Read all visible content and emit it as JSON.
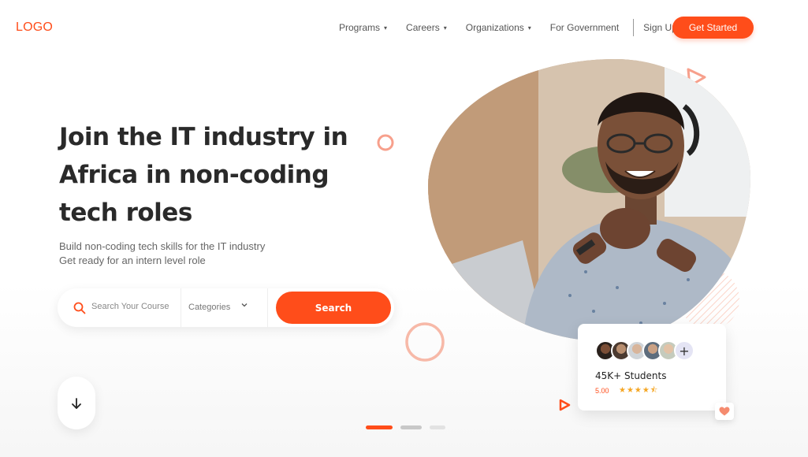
{
  "header": {
    "logo": "LOGO",
    "nav": [
      {
        "label": "Programs",
        "has_dropdown": true
      },
      {
        "label": "Careers",
        "has_dropdown": true
      },
      {
        "label": "Organizations",
        "has_dropdown": true
      },
      {
        "label": "For Government",
        "has_dropdown": false
      }
    ],
    "sign_up": "Sign Up",
    "get_started": "Get Started"
  },
  "hero": {
    "headline_lines": [
      "Join the IT industry in",
      "Africa in non-coding",
      "tech roles"
    ],
    "subtitle_lines": [
      "Build non-coding tech skills for the IT industry",
      "Get ready for an intern level role"
    ],
    "search": {
      "placeholder": "Search Your Course",
      "category_label": "Categories",
      "button_label": "Search"
    }
  },
  "stats_card": {
    "students": "45K+ Students",
    "rating": "5.00",
    "stars": "★★★★⯪",
    "plus": "+"
  },
  "carousel": {
    "active_index": 0,
    "count": 3
  },
  "colors": {
    "accent": "#ff4d1a",
    "text_dark": "#2a2a2a",
    "text_muted": "#666666",
    "star": "#f5a623",
    "deco_pink": "#f7a08c"
  },
  "icons": {
    "search": "search-icon",
    "dropdown": "chevron-down-icon",
    "scroll": "arrow-down-icon",
    "heart": "heart-icon",
    "play": "play-icon"
  }
}
